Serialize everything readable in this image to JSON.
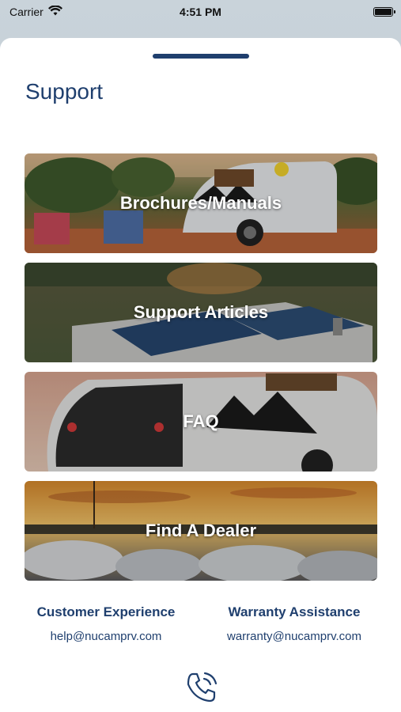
{
  "status_bar": {
    "carrier": "Carrier",
    "time": "4:51 PM"
  },
  "page": {
    "title": "Support"
  },
  "cards": [
    {
      "label": "Brochures/Manuals"
    },
    {
      "label": "Support Articles"
    },
    {
      "label": "FAQ"
    },
    {
      "label": "Find A Dealer"
    }
  ],
  "contacts": {
    "customer": {
      "title": "Customer Experience",
      "email": "help@nucamprv.com"
    },
    "warranty": {
      "title": "Warranty Assistance",
      "email": "warranty@nucamprv.com"
    }
  },
  "icons": {
    "wifi": "wifi-icon",
    "battery": "battery-icon",
    "phone": "phone-icon"
  },
  "colors": {
    "brand_navy": "#1f3f6e",
    "card_text": "#ffffff"
  }
}
